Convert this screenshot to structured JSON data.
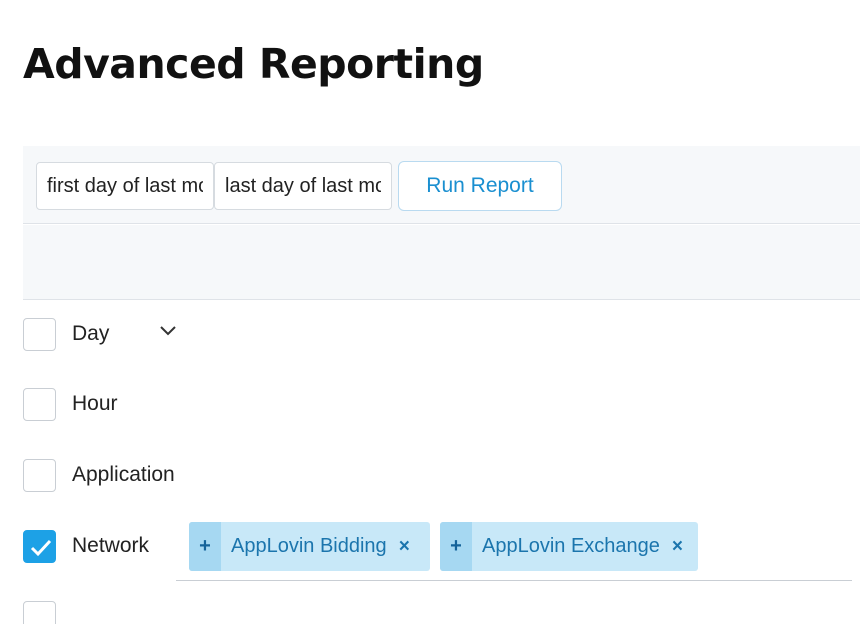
{
  "header": {
    "title": "Advanced Reporting"
  },
  "toolbar": {
    "start_date": "first day of last month",
    "end_date": "last day of last month",
    "run_label": "Run Report"
  },
  "dimensions": [
    {
      "label": "Day",
      "checked": false
    },
    {
      "label": "Hour",
      "checked": false
    },
    {
      "label": "Application",
      "checked": false
    },
    {
      "label": "Network",
      "checked": true
    }
  ],
  "network_tags": [
    {
      "label": "AppLovin Bidding",
      "add_icon": "+",
      "remove_icon": "×"
    },
    {
      "label": "AppLovin Exchange",
      "add_icon": "+",
      "remove_icon": "×"
    }
  ],
  "colors": {
    "accent": "#1da1e6",
    "tag_bg": "#c8e8f8",
    "tag_text": "#1b75ad",
    "toolbar_bg": "#f6f8fa"
  },
  "icons": {
    "day_expand": "chevron-down-icon",
    "network_checked": "checkmark-icon"
  }
}
